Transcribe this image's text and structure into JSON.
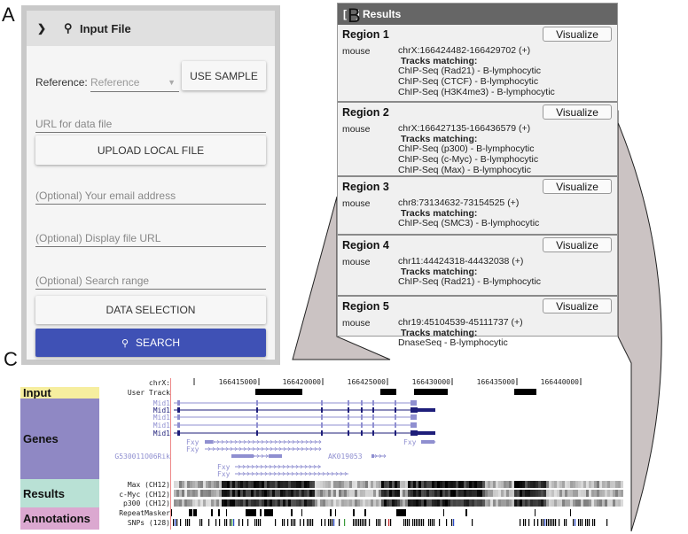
{
  "panel_labels": {
    "a": "A",
    "b": "B",
    "c": "C"
  },
  "input_file": {
    "title": "Input File",
    "collapse_icon": "chevron-down-icon",
    "title_icon": "search-icon",
    "reference_label": "Reference:",
    "reference_placeholder": "Reference",
    "use_sample": "USE SAMPLE",
    "url_placeholder": "URL for data file",
    "upload": "UPLOAD LOCAL FILE",
    "email_placeholder": "(Optional) Your email address",
    "display_url_placeholder": "(Optional) Display file URL",
    "search_range_placeholder": "(Optional) Search range",
    "data_selection": "DATA SELECTION",
    "search": "SEARCH",
    "accent_color": "#3f51b5"
  },
  "results": {
    "header": "[ - ] Results",
    "visualize_label": "Visualize",
    "tracks_matching_label": "Tracks matching:",
    "regions": [
      {
        "title": "Region 1",
        "organism": "mouse",
        "location": "chrX:166424482-166429702 (+)",
        "tracks": [
          "ChIP-Seq (Rad21) - B-lymphocytic",
          "ChIP-Seq (CTCF) - B-lymphocytic",
          "ChIP-Seq (H3K4me3) - B-lymphocytic"
        ]
      },
      {
        "title": "Region 2",
        "organism": "mouse",
        "location": "chrX:166427135-166436579 (+)",
        "tracks": [
          "ChIP-Seq (p300) - B-lymphocytic",
          "ChIP-Seq (c-Myc) - B-lymphocytic",
          "ChIP-Seq (Max) - B-lymphocytic"
        ]
      },
      {
        "title": "Region 3",
        "organism": "mouse",
        "location": "chr8:73134632-73154525 (+)",
        "tracks": [
          "ChIP-Seq (SMC3) - B-lymphocytic"
        ]
      },
      {
        "title": "Region 4",
        "organism": "mouse",
        "location": "chr11:44424318-44432038 (+)",
        "tracks": [
          "ChIP-Seq (Rad21) - B-lymphocytic"
        ]
      },
      {
        "title": "Region 5",
        "organism": "mouse",
        "location": "chr19:45104539-45111737 (+)",
        "tracks": [
          "DnaseSeq - B-lymphocytic"
        ]
      }
    ]
  },
  "browser": {
    "sections": [
      {
        "label": "Input",
        "color": "#f6ee9f"
      },
      {
        "label": "Genes",
        "color": "#8f88c4"
      },
      {
        "label": "Results",
        "color": "#b9e1d5"
      },
      {
        "label": "Annotations",
        "color": "#dba8d0"
      }
    ],
    "ruler": {
      "chrom_label": "chrX:",
      "ticks": [
        "166415000",
        "166420000",
        "166425000",
        "166430000",
        "166435000",
        "166440000"
      ]
    },
    "track_labels": {
      "user_track": "User Track",
      "genes": [
        "Mid1",
        "Mid1",
        "Mid1",
        "Mid1",
        "Mid1",
        "G530011O06Rik"
      ],
      "max": "Max (CH12)",
      "cmyc": "c-Myc (CH12)",
      "p300": "p300 (CH12)",
      "repeatmasker": "RepeatMasker",
      "snps": "SNPs (128)"
    },
    "inline_gene_labels": {
      "fxy": "Fxy",
      "ak": "AK019053"
    },
    "gene_colors": {
      "light": "#8f8fd0",
      "dark": "#1e1e7a"
    }
  }
}
